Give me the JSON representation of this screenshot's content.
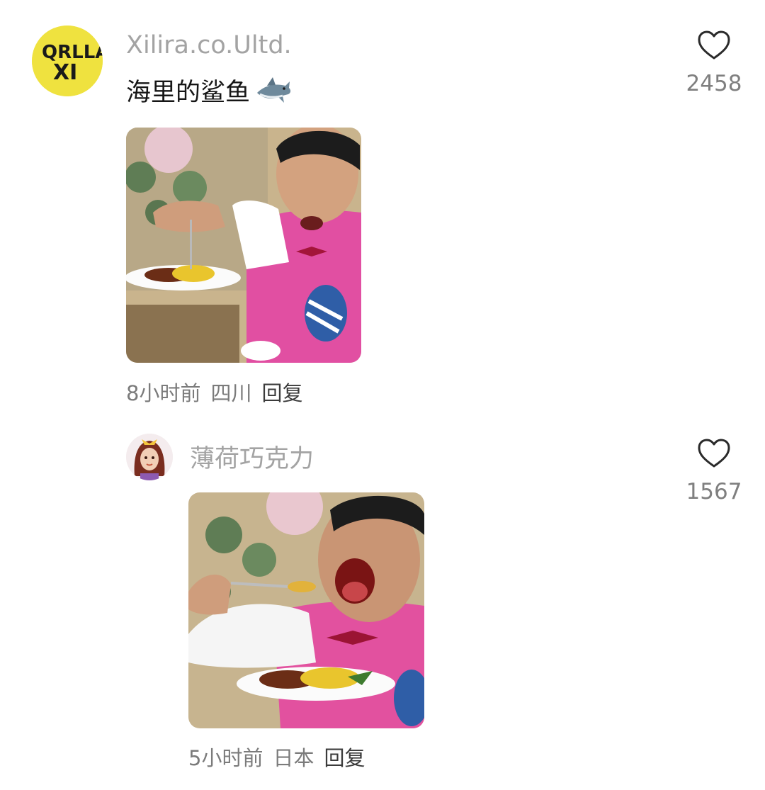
{
  "comments": [
    {
      "username": "Xilira.co.Ultd.",
      "text": "海里的鲨鱼",
      "emoji_icon": "shark-icon",
      "avatar_logo_text": [
        "QRLLA",
        "XI"
      ],
      "time": "8小时前",
      "location": "四川",
      "reply_label": "回复",
      "like_count": "2458",
      "image_description": "man in pink apron holding a plate of curry rice"
    },
    {
      "username": "薄荷巧克力",
      "time": "5小时前",
      "location": "日本",
      "reply_label": "回复",
      "like_count": "1567",
      "image_description": "man in pink apron eating curry rice with a spoon"
    }
  ],
  "colors": {
    "username": "#a3a3a3",
    "meta": "#7b7b7b",
    "count": "#7f7f7f",
    "avatar_bg": "#efe23f"
  }
}
